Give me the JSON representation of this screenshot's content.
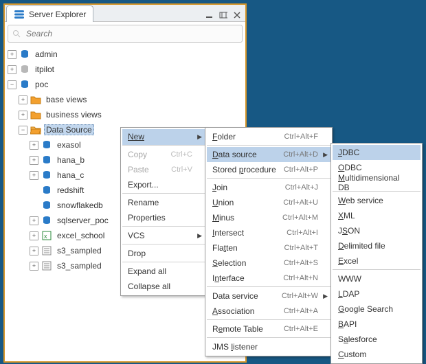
{
  "panel": {
    "title": "Server Explorer"
  },
  "search": {
    "placeholder": "Search"
  },
  "tree": {
    "admin": "admin",
    "itpilot": "itpilot",
    "poc": "poc",
    "base_views": "base views",
    "business_views": "business views",
    "data_source": "Data Source",
    "items": [
      "exasol",
      "hana_b",
      "hana_c",
      "redshift",
      "snowflakedb",
      "sqlserver_poc",
      "excel_school",
      "s3_sampled",
      "s3_sampled"
    ]
  },
  "menu1": {
    "new": "New",
    "copy": "Copy",
    "copy_sc": "Ctrl+C",
    "paste": "Paste",
    "paste_sc": "Ctrl+V",
    "export": "Export...",
    "rename": "Rename",
    "properties": "Properties",
    "vcs": "VCS",
    "drop": "Drop",
    "expand": "Expand all",
    "collapse": "Collapse all"
  },
  "menu2": {
    "folder": "Folder",
    "folder_sc": "Ctrl+Alt+F",
    "datasource": "Data source",
    "datasource_sc": "Ctrl+Alt+D",
    "storedproc": "Stored procedure",
    "storedproc_sc": "Ctrl+Alt+P",
    "join": "Join",
    "join_sc": "Ctrl+Alt+J",
    "union": "Union",
    "union_sc": "Ctrl+Alt+U",
    "minus": "Minus",
    "minus_sc": "Ctrl+Alt+M",
    "intersect": "Intersect",
    "intersect_sc": "Ctrl+Alt+I",
    "flatten": "Flatten",
    "flatten_sc": "Ctrl+Alt+T",
    "selection": "Selection",
    "selection_sc": "Ctrl+Alt+S",
    "interface": "Interface",
    "interface_sc": "Ctrl+Alt+N",
    "dataservice": "Data service",
    "dataservice_sc": "Ctrl+Alt+W",
    "association": "Association",
    "association_sc": "Ctrl+Alt+A",
    "remotetable": "Remote Table",
    "remotetable_sc": "Ctrl+Alt+E",
    "jms": "JMS listener"
  },
  "menu3": {
    "jdbc": "JDBC",
    "odbc": "ODBC",
    "multi": "Multidimensional DB",
    "web": "Web service",
    "xml": "XML",
    "json": "JSON",
    "delim": "Delimited file",
    "excel": "Excel",
    "www": "WWW",
    "ldap": "LDAP",
    "google": "Google Search",
    "bapi": "BAPI",
    "sf": "Salesforce",
    "custom": "Custom"
  }
}
